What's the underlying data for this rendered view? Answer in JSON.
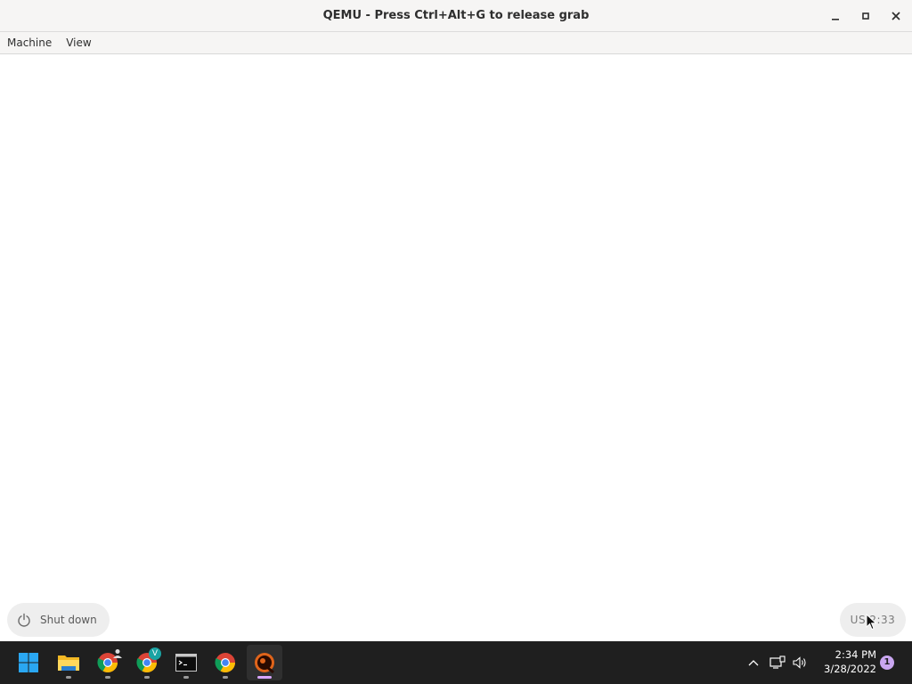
{
  "window": {
    "title": "QEMU - Press Ctrl+Alt+G to release grab"
  },
  "menubar": {
    "items": [
      {
        "label": "Machine"
      },
      {
        "label": "View"
      }
    ]
  },
  "guest": {
    "shutdown_label": "Shut down",
    "keyboard_label": "US 2:33"
  },
  "taskbar": {
    "apps": [
      {
        "name": "start",
        "icon": "windows-start-icon"
      },
      {
        "name": "file-explorer",
        "icon": "folder-icon"
      },
      {
        "name": "chrome-profile-1",
        "icon": "chrome-icon"
      },
      {
        "name": "chrome-profile-2",
        "icon": "chrome-icon",
        "badge": "V"
      },
      {
        "name": "terminal",
        "icon": "terminal-icon"
      },
      {
        "name": "chrome",
        "icon": "chrome-icon"
      },
      {
        "name": "qemu",
        "icon": "qemu-icon",
        "active": true
      }
    ],
    "clock": {
      "time": "2:34 PM",
      "date": "3/28/2022"
    },
    "notification_count": "1"
  },
  "colors": {
    "taskbar_bg": "#1f1f1f",
    "accent_indicator": "#d9a6ff",
    "titlebar_bg": "#f6f5f4"
  }
}
